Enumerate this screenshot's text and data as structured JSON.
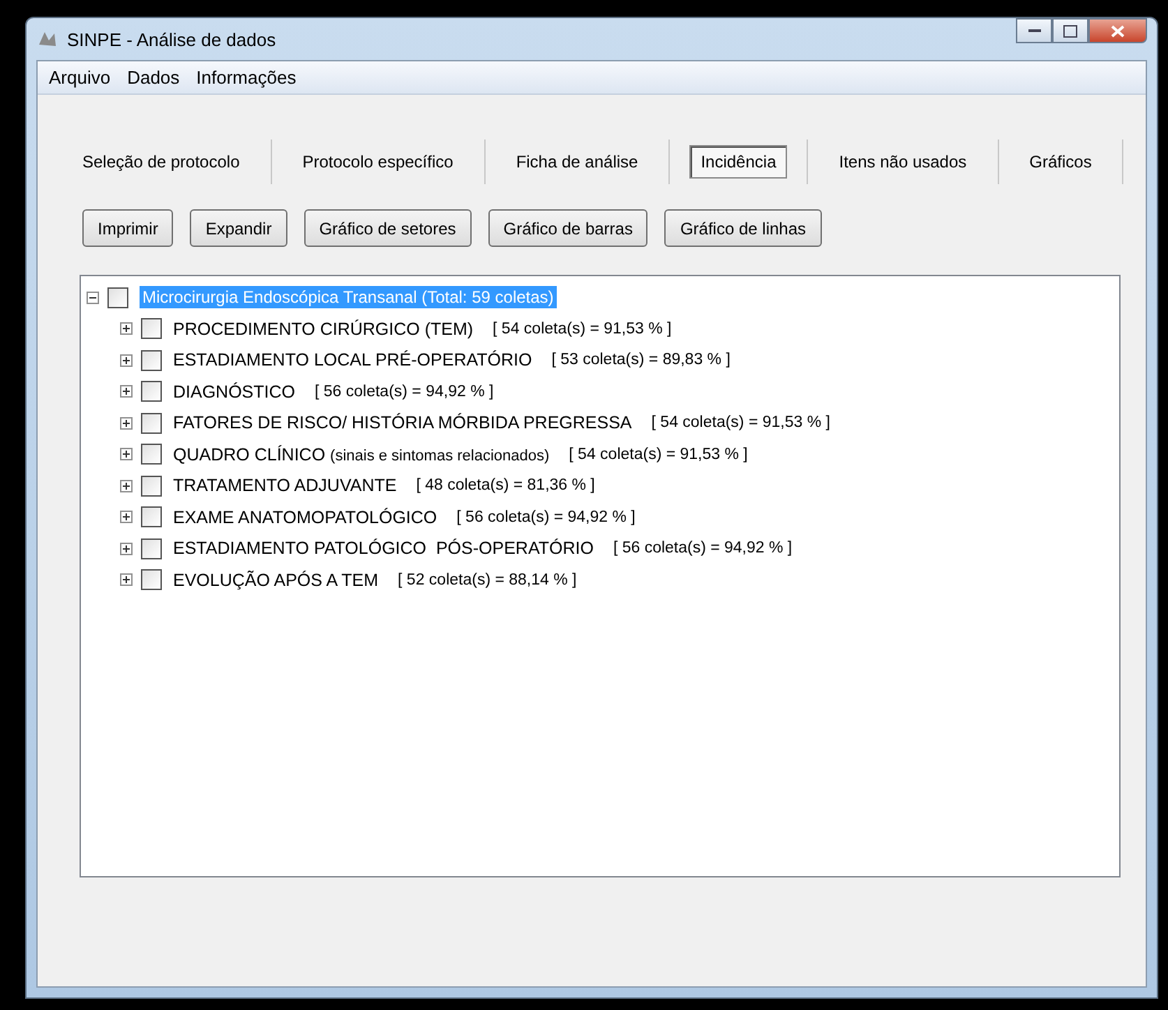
{
  "window": {
    "title": "SINPE - Análise de dados"
  },
  "menu": [
    "Arquivo",
    "Dados",
    "Informações"
  ],
  "tabs": [
    {
      "label": "Seleção de protocolo",
      "selected": false
    },
    {
      "label": "Protocolo específico",
      "selected": false
    },
    {
      "label": "Ficha de análise",
      "selected": false
    },
    {
      "label": "Incidência",
      "selected": true
    },
    {
      "label": "Itens não usados",
      "selected": false
    },
    {
      "label": "Gráficos",
      "selected": false
    }
  ],
  "buttons": [
    "Imprimir",
    "Expandir",
    "Gráfico de setores",
    "Gráfico de barras",
    "Gráfico de linhas"
  ],
  "tree": {
    "label": "Microcirurgia Endoscópica Transanal (Total: 59 coletas)",
    "expanded": true,
    "selected": true,
    "checked": false,
    "children": [
      {
        "name": "PROCEDIMENTO CIRÚRGICO (TEM)",
        "count": "[ 54 coleta(s) = 91,53 % ]",
        "expanded": false,
        "checked": false
      },
      {
        "name": "ESTADIAMENTO LOCAL PRÉ-OPERATÓRIO",
        "count": "[ 53 coleta(s) = 89,83 % ]",
        "expanded": false,
        "checked": false
      },
      {
        "name": "DIAGNÓSTICO",
        "count": "[ 56 coleta(s) = 94,92 % ]",
        "expanded": false,
        "checked": false
      },
      {
        "name": "FATORES DE RISCO/ HISTÓRIA MÓRBIDA PREGRESSA",
        "count": "[ 54 coleta(s) = 91,53 % ]",
        "expanded": false,
        "checked": false
      },
      {
        "name": "QUADRO CLÍNICO",
        "note": "(sinais e sintomas relacionados)",
        "count": "[ 54 coleta(s) = 91,53 % ]",
        "expanded": false,
        "checked": false
      },
      {
        "name": "TRATAMENTO ADJUVANTE",
        "count": "[ 48 coleta(s) = 81,36 % ]",
        "expanded": false,
        "checked": false
      },
      {
        "name": "EXAME ANATOMOPATOLÓGICO",
        "count": "[ 56 coleta(s) = 94,92 % ]",
        "expanded": false,
        "checked": false
      },
      {
        "name": "ESTADIAMENTO PATOLÓGICO  PÓS-OPERATÓRIO",
        "count": "[ 56 coleta(s) = 94,92 % ]",
        "expanded": false,
        "checked": false
      },
      {
        "name": "EVOLUÇÃO APÓS A TEM",
        "count": "[ 52 coleta(s) = 88,14 % ]",
        "expanded": false,
        "checked": false
      }
    ]
  }
}
